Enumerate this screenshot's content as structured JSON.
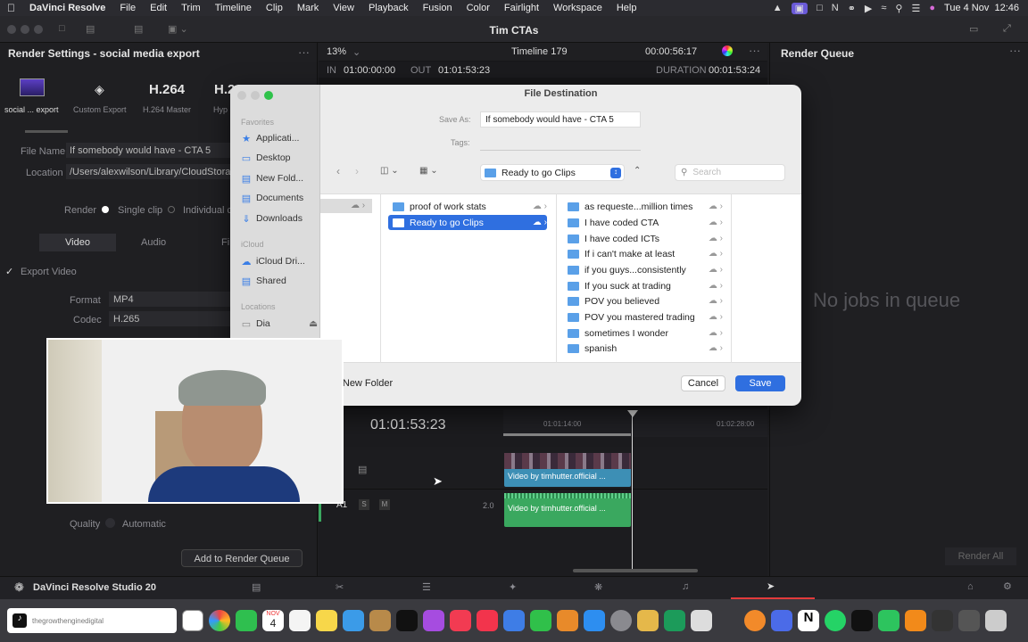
{
  "menubar": {
    "app": "DaVinci Resolve",
    "items": [
      "File",
      "Edit",
      "Trim",
      "Timeline",
      "Clip",
      "Mark",
      "View",
      "Playback",
      "Fusion",
      "Color",
      "Fairlight",
      "Workspace",
      "Help"
    ],
    "datetime": "Tue 4 Nov  12:46"
  },
  "window": {
    "title": "Tim CTAs"
  },
  "render_settings": {
    "title": "Render Settings - social media export",
    "presets": [
      {
        "label": "social ... export"
      },
      {
        "label": "Custom Export"
      },
      {
        "label": "H.264 Master",
        "big": "H.264"
      },
      {
        "label": "Hyp",
        "big": "H.26"
      }
    ],
    "file_name_label": "File Name",
    "file_name_value": "If somebody would have - CTA 5",
    "location_label": "Location",
    "location_value": "/Users/alexwilson/Library/CloudStorage",
    "render_label": "Render",
    "single_clip": "Single clip",
    "individual": "Individual cl",
    "tabs": [
      "Video",
      "Audio",
      "Fi"
    ],
    "export_video": "Export Video",
    "format_label": "Format",
    "format_value": "MP4",
    "codec_label": "Codec",
    "codec_value": "H.265",
    "quality_label": "Quality",
    "quality_value": "Automatic",
    "add_button": "Add to Render Queue"
  },
  "viewer": {
    "zoom": "13%",
    "timeline_name": "Timeline 179",
    "timecode": "00:00:56:17",
    "in_label": "IN",
    "in_value": "01:00:00:00",
    "out_label": "OUT",
    "out_value": "01:01:53:23",
    "duration_label": "DURATION",
    "duration_value": "00:01:53:24"
  },
  "timeline": {
    "current_tc": "01:01:53:23",
    "ruler_marks": [
      "01:01:14:00",
      "01:02:28:00"
    ],
    "audio_track": "A1",
    "audio_level": "2.0",
    "video_clip": "Video by timhutter.official ...",
    "audio_clip": "Video by timhutter.official ..."
  },
  "render_queue": {
    "title": "Render Queue",
    "empty": "No jobs in queue",
    "render_all": "Render All"
  },
  "dialog": {
    "title": "File Destination",
    "save_as_label": "Save As:",
    "save_as_value": "If somebody would have - CTA 5",
    "tags_label": "Tags:",
    "location_popup": "Ready to go Clips",
    "search_placeholder": "Search",
    "sidebar": {
      "favorites": "Favorites",
      "fav_items": [
        "Applicati...",
        "Desktop",
        "New Fold...",
        "Documents",
        "Downloads"
      ],
      "icloud": "iCloud",
      "icloud_items": [
        "iCloud Dri...",
        "Shared"
      ],
      "locations": "Locations",
      "loc_items": [
        "Dia"
      ]
    },
    "column2": [
      "proof of work  stats",
      "Ready to go Clips"
    ],
    "column3": [
      "as requeste...million times",
      "I have coded CTA",
      "I have coded ICTs",
      "If i can't make at least",
      "if you guys...consistently",
      "If you suck at trading",
      "POV you believed",
      "POV you mastered trading",
      "sometimes I wonder",
      "spanish"
    ],
    "new_folder": "New Folder",
    "cancel": "Cancel",
    "save": "Save"
  },
  "bottombar": {
    "product": "DaVinci Resolve Studio 20"
  },
  "dock": {
    "tiktok_label": "thegrowthenginedigital",
    "calendar_month": "NOV",
    "calendar_day": "4"
  },
  "colors": {
    "accent": "#2f6fe0",
    "clip_video": "#3d8fb5",
    "clip_audio": "#3aa85f",
    "deliver_red": "#e33b3b"
  }
}
